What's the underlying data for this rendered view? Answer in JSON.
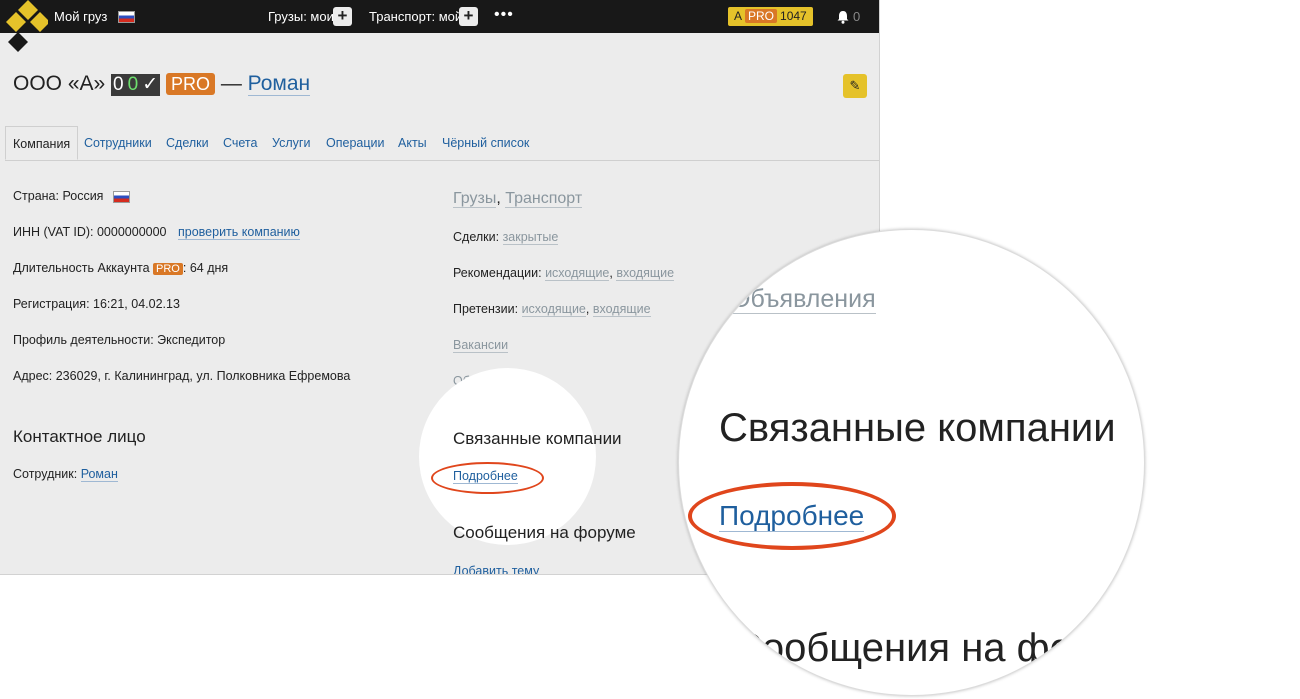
{
  "topbar": {
    "my_cargo": "Мой груз",
    "cargo_mine": "Грузы: мои",
    "transport_mine": "Транспорт: мой",
    "plus": "+",
    "more": "•••",
    "balance_letter": "A",
    "balance_pro": "PRO",
    "balance_value": "1047",
    "notifications": "0"
  },
  "header": {
    "company": "ООО «А»",
    "badge_zero1": "0",
    "badge_zero2": "0",
    "badge_check": "✓",
    "badge_pro": "PRO",
    "dash": "—",
    "owner": "Роман",
    "edit_icon": "✎"
  },
  "tabs": [
    "Компания",
    "Сотрудники",
    "Сделки",
    "Счета",
    "Услуги",
    "Операции",
    "Акты",
    "Чёрный список"
  ],
  "info": {
    "country_label": "Страна: Россия",
    "inn_label": "ИНН (VAT ID): 0000000000",
    "check_company": "проверить компанию",
    "duration_label": "Длительность Аккаунта",
    "duration_pro": "PRO",
    "duration_value": ": 64 дня",
    "registration": "Регистрация: 16:21, 04.02.13",
    "profile": "Профиль деятельности: Экспедитор",
    "address": "Адрес: 236029, г. Калининград, ул. Полковника Ефремова",
    "contact_heading": "Контактное лицо",
    "employee_label": "Сотрудник:",
    "employee_name": "Роман"
  },
  "right": {
    "cargo": "Грузы",
    "comma": ",",
    "transport": "Транспорт",
    "deals_label": "Сделки:",
    "deals_closed": "закрытые",
    "recs_label": "Рекомендации:",
    "outgoing": "исходящие",
    "incoming": "входящие",
    "claims_label": "Претензии:",
    "vacancies": "Вакансии",
    "ads": "Объявления",
    "related_heading": "Связанные компании",
    "more_link": "Подробнее",
    "forum_heading": "Сообщения на форуме",
    "add_topic": "Добавить тему"
  },
  "magnifier": {
    "ads": "Объявления",
    "related_heading": "Связанные компании",
    "more_link": "Подробнее",
    "forum_heading": "Сообщения на форуме"
  },
  "colors": {
    "accent_yellow": "#e5c22a",
    "pro_orange": "#d97826",
    "link_blue": "#1f5f9e",
    "highlight_red": "#e0461c"
  }
}
